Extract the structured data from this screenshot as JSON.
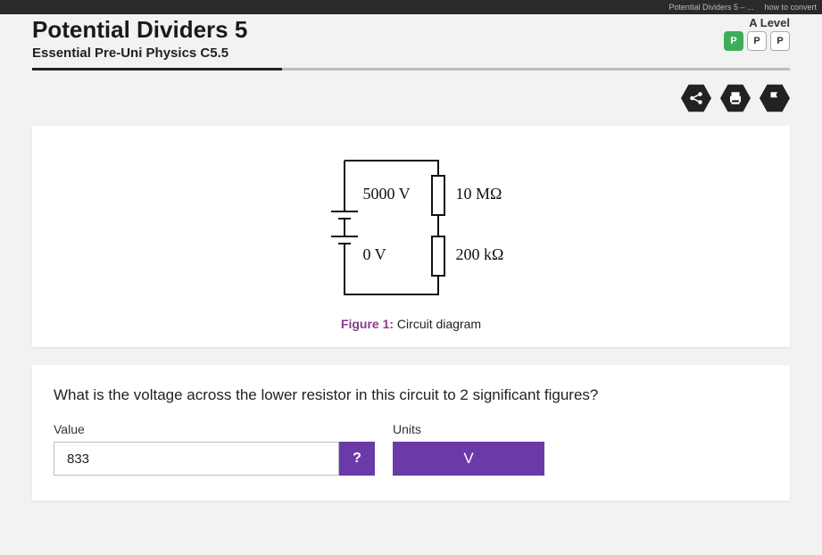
{
  "browser": {
    "tab1": "Potential Dividers 5 – ...",
    "tab2": "how to convert"
  },
  "header": {
    "title": "Potential Dividers 5",
    "subtitle": "Essential Pre-Uni Physics C5.5",
    "level_label": "A Level",
    "hex1": "P",
    "hex2": "P",
    "hex3": "P"
  },
  "figure": {
    "v_high": "5000 V",
    "v_low": "0 V",
    "r_top": "10 MΩ",
    "r_bottom": "200 kΩ",
    "caption_prefix": "Figure 1:",
    "caption_text": " Circuit diagram"
  },
  "question": {
    "text": "What is the voltage across the lower resistor in this circuit to 2 significant figures?",
    "value_label": "Value",
    "value_input": "833",
    "help_label": "?",
    "units_label": "Units",
    "units_value": "V"
  }
}
